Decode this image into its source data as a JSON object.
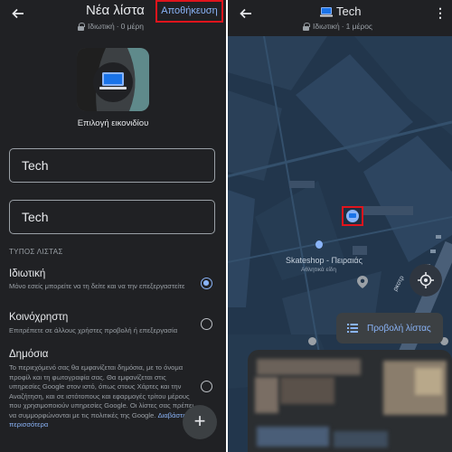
{
  "left_panel": {
    "header": {
      "title": "Νέα λίστα",
      "subtitle_privacy": "Ιδιωτική",
      "subtitle_count": "0 μέρη",
      "save_label": "Αποθήκευση"
    },
    "icon_picker": {
      "label": "Επιλογή εικονιδίου"
    },
    "fields": {
      "name_value": "Tech",
      "description_value": "Tech"
    },
    "list_type": {
      "section_label": "ΤΥΠΟΣ ΛΙΣΤΑΣ",
      "options": [
        {
          "title": "Ιδιωτική",
          "description": "Μόνο εσείς μπορείτε να τη δείτε και να την επεξεργαστείτε",
          "selected": true
        },
        {
          "title": "Κοινόχρηστη",
          "description": "Επιτρέπετε σε άλλους χρήστες προβολή ή επεξεργασία",
          "selected": false
        },
        {
          "title": "Δημόσια",
          "description": "Το περιεχόμενό σας θα εμφανίζεται δημόσια, με το όνομα προφίλ και τη φωτογραφία σας. Θα εμφανίζεται στις υπηρεσίες Google στον ιστό, όπως στους Χάρτες και την Αναζήτηση, και σε ιστότοπους και εφαρμογές τρίτου μέρους που χρησιμοποιούν υπηρεσίες Google. Οι λίστες σας πρέπει να συμμορφώνονται με τις πολιτικές της Google.",
          "link": "Διαβάστε περισσότερα",
          "selected": false
        }
      ]
    },
    "fab_symbol": "+"
  },
  "right_panel": {
    "header": {
      "title": "Tech",
      "subtitle_privacy": "Ιδιωτική",
      "subtitle_count": "1 μέρος"
    },
    "map": {
      "poi_name": "Skateshop - Πειραιάς",
      "poi_category": "Αθλητικά είδη",
      "street_fragment": "ρκοτρ"
    },
    "list_view_label": "Προβολή λίστας"
  },
  "colors": {
    "dark_bg": "#202124",
    "map_bg": "#1d3043",
    "accent_blue": "#8ab4f8",
    "highlight_red": "#e0141c"
  },
  "icons": [
    "back-arrow-icon",
    "lock-icon",
    "laptop-icon",
    "more-vert-icon",
    "pin-icon",
    "my-location-icon",
    "list-icon",
    "plus-icon"
  ]
}
